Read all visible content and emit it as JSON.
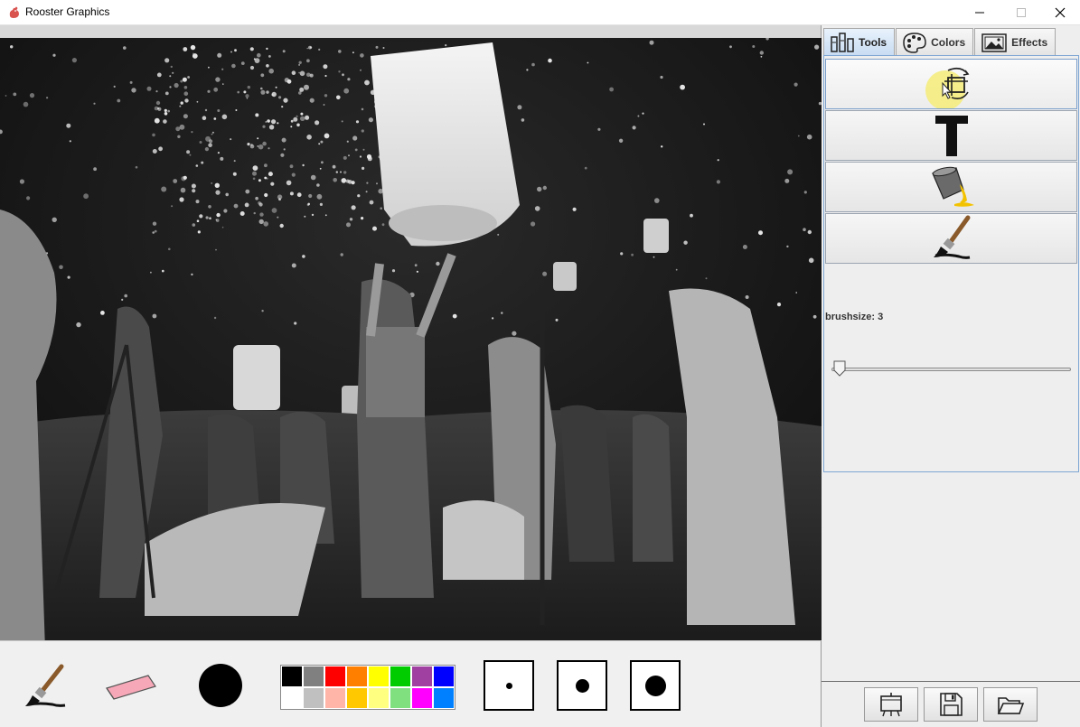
{
  "window": {
    "title": "Rooster Graphics",
    "controls": [
      "minimize",
      "maximize",
      "close"
    ]
  },
  "canvas": {
    "image_description_icon": "photo-canvas"
  },
  "bottom_toolbar": {
    "tools": [
      "paintbrush-icon",
      "eraser-icon",
      "current-color-circle"
    ],
    "current_color": "#000000",
    "palette": {
      "top_row": [
        "#000000",
        "#808080",
        "#ff0000",
        "#ff8000",
        "#ffff00",
        "#00cc00",
        "#a040a0",
        "#0000ff"
      ],
      "bottom_row": [
        "#ffffff",
        "#c0c0c0",
        "#ffb6a8",
        "#ffc800",
        "#ffff80",
        "#80e080",
        "#ff00ff",
        "#0080ff"
      ]
    },
    "sizes": [
      "small",
      "medium",
      "large"
    ]
  },
  "right_panel": {
    "tabs": [
      {
        "label": "Tools",
        "icon": "tools-icon",
        "active": true
      },
      {
        "label": "Colors",
        "icon": "palette-icon",
        "active": false
      },
      {
        "label": "Effects",
        "icon": "picture-icon",
        "active": false
      }
    ],
    "tool_buttons": [
      "crop-rotate-icon",
      "text-tool-icon",
      "paint-bucket-icon",
      "paintbrush-icon"
    ],
    "brushsize_label": "brushsize: 3",
    "brushsize_value": 3,
    "bottom_buttons": [
      "canvas-icon",
      "save-icon",
      "open-folder-icon"
    ]
  }
}
